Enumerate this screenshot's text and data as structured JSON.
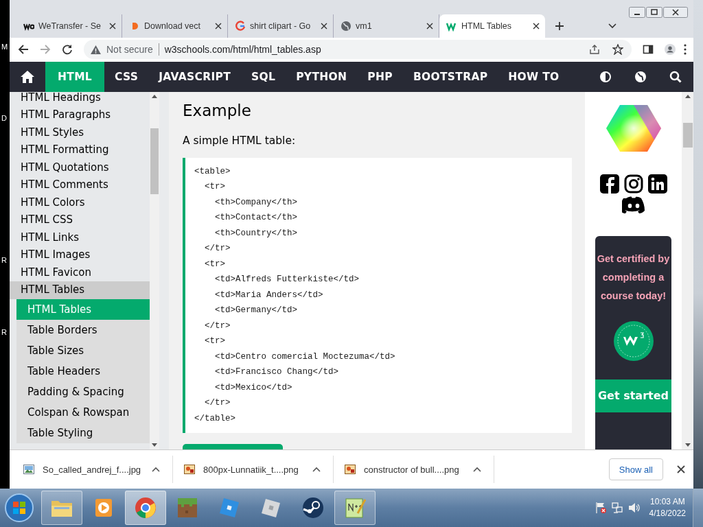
{
  "desktop_labels": [
    "M",
    "D",
    "R",
    "R"
  ],
  "tabs": [
    {
      "title": "WeTransfer - Se",
      "selected": false
    },
    {
      "title": "Download vect",
      "selected": false
    },
    {
      "title": "shirt clipart - Go",
      "selected": false
    },
    {
      "title": "vm1",
      "selected": false
    },
    {
      "title": "HTML Tables",
      "selected": true
    }
  ],
  "address": {
    "security": "Not secure",
    "url": "w3schools.com/html/html_tables.asp"
  },
  "nav": [
    {
      "label": "HTML",
      "selected": true
    },
    {
      "label": "CSS",
      "selected": false
    },
    {
      "label": "JAVASCRIPT",
      "selected": false
    },
    {
      "label": "SQL",
      "selected": false
    },
    {
      "label": "PYTHON",
      "selected": false
    },
    {
      "label": "PHP",
      "selected": false
    },
    {
      "label": "BOOTSTRAP",
      "selected": false
    },
    {
      "label": "HOW TO",
      "selected": false
    }
  ],
  "sidebar": [
    {
      "label": "HTML Headings",
      "selected": false
    },
    {
      "label": "HTML Paragraphs",
      "selected": false
    },
    {
      "label": "HTML Styles",
      "selected": false
    },
    {
      "label": "HTML Formatting",
      "selected": false
    },
    {
      "label": "HTML Quotations",
      "selected": false
    },
    {
      "label": "HTML Comments",
      "selected": false
    },
    {
      "label": "HTML Colors",
      "selected": false
    },
    {
      "label": "HTML CSS",
      "selected": false
    },
    {
      "label": "HTML Links",
      "selected": false
    },
    {
      "label": "HTML Images",
      "selected": false
    },
    {
      "label": "HTML Favicon",
      "selected": false
    },
    {
      "label": "HTML Tables",
      "selected": false,
      "expanded": true,
      "children": [
        {
          "label": "HTML Tables",
          "selected": true
        },
        {
          "label": "Table Borders",
          "selected": false
        },
        {
          "label": "Table Sizes",
          "selected": false
        },
        {
          "label": "Table Headers",
          "selected": false
        },
        {
          "label": "Padding & Spacing",
          "selected": false
        },
        {
          "label": "Colspan & Rowspan",
          "selected": false
        },
        {
          "label": "Table Styling",
          "selected": false
        }
      ]
    }
  ],
  "example": {
    "heading": "Example",
    "intro": "A simple HTML table:",
    "code": [
      "<table>",
      "  <tr>",
      "    <th>Company</th>",
      "    <th>Contact</th>",
      "    <th>Country</th>",
      "  </tr>",
      "  <tr>",
      "    <td>Alfreds Futterkiste</td>",
      "    <td>Maria Anders</td>",
      "    <td>Germany</td>",
      "  </tr>",
      "  <tr>",
      "    <td>Centro comercial Moctezuma</td>",
      "    <td>Francisco Chang</td>",
      "    <td>Mexico</td>",
      "  </tr>",
      "</table>"
    ]
  },
  "promo": {
    "text": "Get certified by completing a course today!",
    "button": "Get started"
  },
  "downloads": [
    {
      "name": "So_called_andrej_f....jpg",
      "kind": "jpg"
    },
    {
      "name": "800px-Lunnatiik_t....png",
      "kind": "png"
    },
    {
      "name": "constructor of bull....png",
      "kind": "png"
    }
  ],
  "show_all": "Show all",
  "taskbar": [
    {
      "kind": "folder",
      "running": true,
      "selected": false
    },
    {
      "kind": "player",
      "running": false,
      "selected": false
    },
    {
      "kind": "browser",
      "running": true,
      "selected": true
    },
    {
      "kind": "grass",
      "running": false,
      "selected": false
    },
    {
      "kind": "bluetile",
      "running": false,
      "selected": false
    },
    {
      "kind": "graytile",
      "running": false,
      "selected": false
    },
    {
      "kind": "steam",
      "running": false,
      "selected": false
    },
    {
      "kind": "notepad",
      "running": true,
      "selected": false
    }
  ],
  "clock": {
    "time": "10:03 AM",
    "date": "4/18/2022"
  }
}
